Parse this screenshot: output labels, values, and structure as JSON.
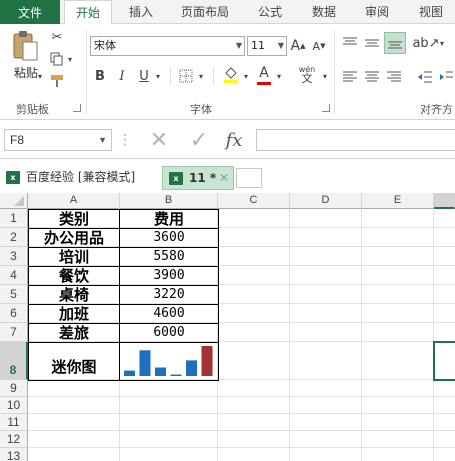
{
  "ribbon_tabs": {
    "file": "文件",
    "home": "开始",
    "insert": "插入",
    "page_layout": "页面布局",
    "formulas": "公式",
    "data": "数据",
    "review": "审阅",
    "view": "视图"
  },
  "clipboard": {
    "paste_label": "粘贴",
    "group_label": "剪贴板"
  },
  "font": {
    "name": "宋体",
    "size": "11",
    "group_label": "字体",
    "bold": "B",
    "italic": "I",
    "underline": "U",
    "increase": "A",
    "decrease": "A",
    "phonetic": "wén",
    "font_color_letter": "A"
  },
  "alignment": {
    "group_label": "对齐方"
  },
  "formula_bar": {
    "cell_ref": "F8",
    "fx": "fx",
    "content": ""
  },
  "workbook_tabs": [
    {
      "label": "百度经验  [兼容模式]",
      "active": false
    },
    {
      "label": "11 *",
      "active": true
    }
  ],
  "columns": [
    "A",
    "B",
    "C",
    "D",
    "E"
  ],
  "rows": [
    "1",
    "2",
    "3",
    "4",
    "5",
    "6",
    "7",
    "8",
    "9",
    "10",
    "11",
    "12",
    "13"
  ],
  "table": {
    "header": {
      "a": "类别",
      "b": "费用"
    },
    "data": [
      {
        "a": "办公用品",
        "b": "3600"
      },
      {
        "a": "培训",
        "b": "5580"
      },
      {
        "a": "餐饮",
        "b": "3900"
      },
      {
        "a": "桌椅",
        "b": "3220"
      },
      {
        "a": "加班",
        "b": "4600"
      },
      {
        "a": "差旅",
        "b": "6000"
      }
    ],
    "sparkline_label": "迷你图"
  },
  "sparkline": {
    "values": [
      3600,
      5580,
      3900,
      3220,
      4600,
      6000
    ],
    "min": 3220,
    "color": "#1f6fbf",
    "high_color": "#a33232"
  },
  "colors": {
    "accent": "#217346",
    "selection": "#217346"
  }
}
